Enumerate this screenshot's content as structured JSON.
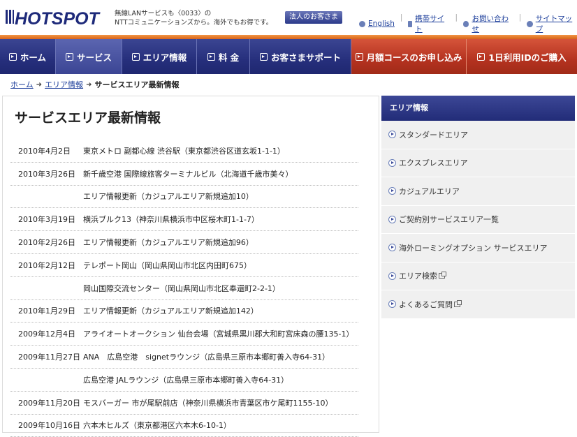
{
  "header": {
    "logo_text": "HOTSPOT",
    "tagline_line1": "無線LANサービスも〈0033〉の",
    "tagline_line2": "NTTコミュニケーションズから。海外でもお得です。",
    "corp_button": "法人のお客さま",
    "links": [
      {
        "label": "English",
        "icon": "globe-icon"
      },
      {
        "label": "携帯サイト",
        "icon": "mobile-icon"
      },
      {
        "label": "お問い合わせ",
        "icon": "phone-icon"
      },
      {
        "label": "サイトマップ",
        "icon": "arrow-icon"
      }
    ]
  },
  "nav": [
    {
      "label": "ホーム"
    },
    {
      "label": "サービス"
    },
    {
      "label": "エリア情報"
    },
    {
      "label": "料 金"
    },
    {
      "label": "お客さまサポート"
    },
    {
      "label": "月額コースのお申し込み"
    },
    {
      "label": "1日利用IDのご購入"
    }
  ],
  "breadcrumb": {
    "home": "ホーム",
    "area": "エリア情報",
    "current": "サービスエリア最新情報"
  },
  "main": {
    "title": "サービスエリア最新情報",
    "news": [
      {
        "date": "2010年4月2日",
        "text": "東京メトロ 副都心線 渋谷駅（東京都渋谷区道玄坂1-1-1）"
      },
      {
        "date": "2010年3月26日",
        "text": "新千歳空港 国際線旅客ターミナルビル（北海道千歳市美々）"
      },
      {
        "date": "",
        "text": "エリア情報更新（カジュアルエリア新規追加10）"
      },
      {
        "date": "2010年3月19日",
        "text": "横浜ブルク13（神奈川県横浜市中区桜木町1-1-7）"
      },
      {
        "date": "2010年2月26日",
        "text": "エリア情報更新（カジュアルエリア新規追加96）"
      },
      {
        "date": "2010年2月12日",
        "text": "テレポート岡山（岡山県岡山市北区内田町675）"
      },
      {
        "date": "",
        "text": "岡山国際交流センター（岡山県岡山市北区奉還町2-2-1）"
      },
      {
        "date": "2010年1月29日",
        "text": "エリア情報更新（カジュアルエリア新規追加142）"
      },
      {
        "date": "2009年12月4日",
        "text": "アライオートオークション 仙台会場（宮城県黒川郡大和町宮床森の腰135-1）"
      },
      {
        "date": "2009年11月27日",
        "text": "ANA　広島空港　signetラウンジ（広島県三原市本郷町善入寺64-31）"
      },
      {
        "date": "",
        "text": "広島空港 JALラウンジ（広島県三原市本郷町善入寺64-31）"
      },
      {
        "date": "2009年11月20日",
        "text": "モスバーガー 市が尾駅前店（神奈川県横浜市青葉区市ケ尾町1155-10）"
      },
      {
        "date": "2009年10月16日",
        "text": "六本木ヒルズ（東京都港区六本木6-10-1）"
      }
    ]
  },
  "sidebar": {
    "heading": "エリア情報",
    "items": [
      {
        "label": "スタンダードエリア",
        "external": false
      },
      {
        "label": "エクスプレスエリア",
        "external": false
      },
      {
        "label": "カジュアルエリア",
        "external": false
      },
      {
        "label": "ご契約別サービスエリア一覧",
        "external": false
      },
      {
        "label": "海外ローミングオプション サービスエリア",
        "external": false
      },
      {
        "label": "エリア検索",
        "external": true
      },
      {
        "label": "よくあるご質問",
        "external": true
      }
    ]
  },
  "colors": {
    "nav_blue": "#262f7c",
    "nav_orange": "#b43220",
    "link_blue": "#1b3d9a",
    "accent_orange": "#e27a2c"
  }
}
